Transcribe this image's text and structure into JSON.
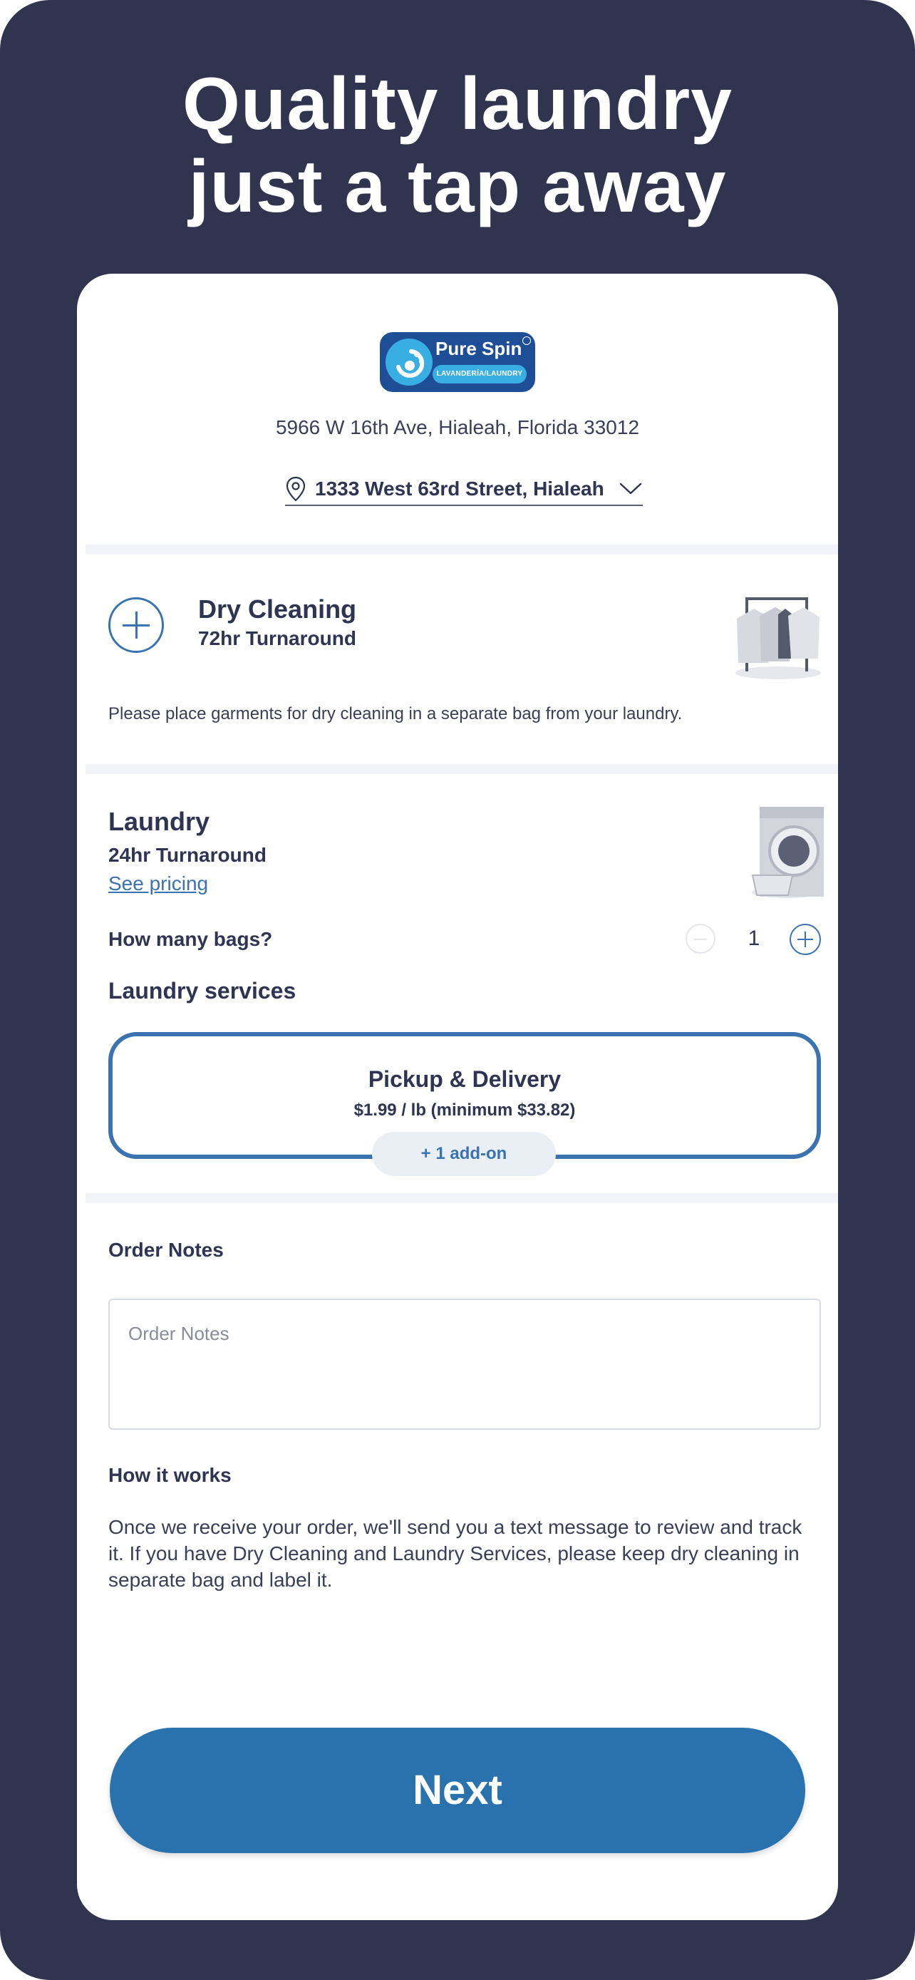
{
  "headline": {
    "line1": "Quality laundry",
    "line2": "just a tap away"
  },
  "brand": {
    "name": "Pure Spin",
    "tagline": "LAVANDERÍA/LAUNDRY"
  },
  "store": {
    "address": "5966 W 16th Ave, Hialeah, Florida 33012",
    "selected_location": "1333 West 63rd Street, Hialeah"
  },
  "dry_cleaning": {
    "title": "Dry Cleaning",
    "turnaround": "72hr Turnaround",
    "note": "Please place garments for dry cleaning in a separate bag from your laundry."
  },
  "laundry": {
    "title": "Laundry",
    "turnaround": "24hr Turnaround",
    "pricing_link": "See pricing",
    "bags_label": "How many bags?",
    "bags_count": "1",
    "services_title": "Laundry services",
    "service": {
      "name": "Pickup & Delivery",
      "price": "$1.99 / lb (minimum $33.82)",
      "addon": "+ 1 add-on"
    }
  },
  "order_notes": {
    "title": "Order Notes",
    "placeholder": "Order Notes"
  },
  "how_it_works": {
    "title": "How it works",
    "body": "Once we receive your order, we'll send you a text message to review and track it. If you have Dry Cleaning and Laundry Services, please keep dry cleaning in separate bag and label it."
  },
  "next_label": "Next",
  "colors": {
    "background": "#30344f",
    "accent": "#3a73b0",
    "button": "#2a72ad",
    "brand": "#1d4e96"
  }
}
